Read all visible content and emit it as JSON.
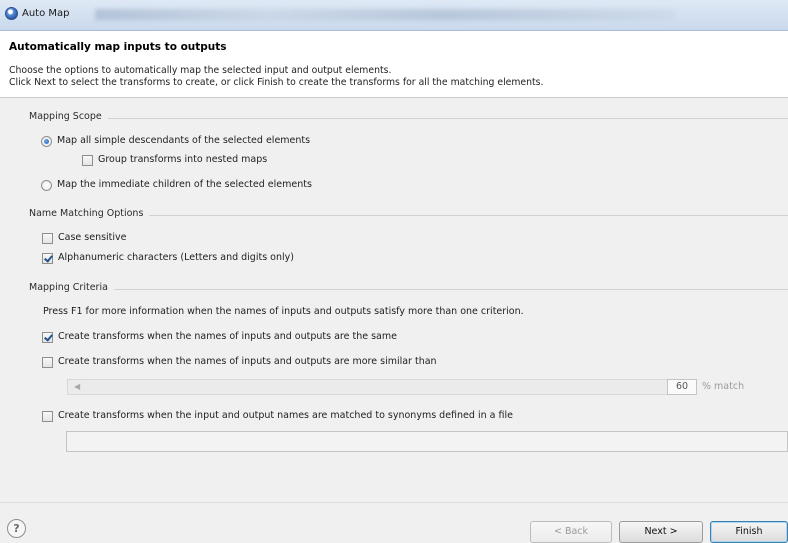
{
  "window": {
    "title": "Auto Map"
  },
  "banner": {
    "title": "Automatically map inputs to outputs",
    "line1": "Choose the options to automatically map the selected input and output elements.",
    "line2": "Click Next to select the transforms to create, or click Finish to create the transforms for all the matching elements."
  },
  "scope": {
    "header": "Mapping Scope",
    "option_all": {
      "label": "Map all simple descendants of the selected elements",
      "checked": true
    },
    "group_nested": {
      "label": "Group transforms into nested maps",
      "checked": false
    },
    "option_children": {
      "label": "Map the immediate children of the selected elements",
      "checked": false
    }
  },
  "matching": {
    "header": "Name Matching Options",
    "case_sensitive": {
      "label": "Case sensitive",
      "checked": false
    },
    "alphanumeric": {
      "label": "Alphanumeric characters (Letters and digits only)",
      "checked": true
    }
  },
  "criteria": {
    "header": "Mapping Criteria",
    "hint": "Press F1 for more information when the names of inputs and outputs satisfy more than one criterion.",
    "same": {
      "label": "Create transforms when the names of inputs and outputs are the same",
      "checked": true
    },
    "similar": {
      "label": "Create transforms when the names of inputs and outputs are more similar than",
      "checked": false
    },
    "similarity_value": "60",
    "similarity_unit": "% match",
    "synonyms": {
      "label": "Create transforms when the input and output names are matched to synonyms defined in a file",
      "checked": false
    },
    "file_value": ""
  },
  "footer": {
    "help_glyph": "?",
    "back": "< Back",
    "next": "Next >",
    "finish": "Finish"
  },
  "icons": {
    "app": "auto-map-app-icon",
    "help": "help-icon"
  },
  "colors": {
    "dialog_bg": "#f0f0f0",
    "banner_bg": "#ffffff",
    "titlebar": "#c9d9ec",
    "default_button_border": "#3c7fb1"
  }
}
